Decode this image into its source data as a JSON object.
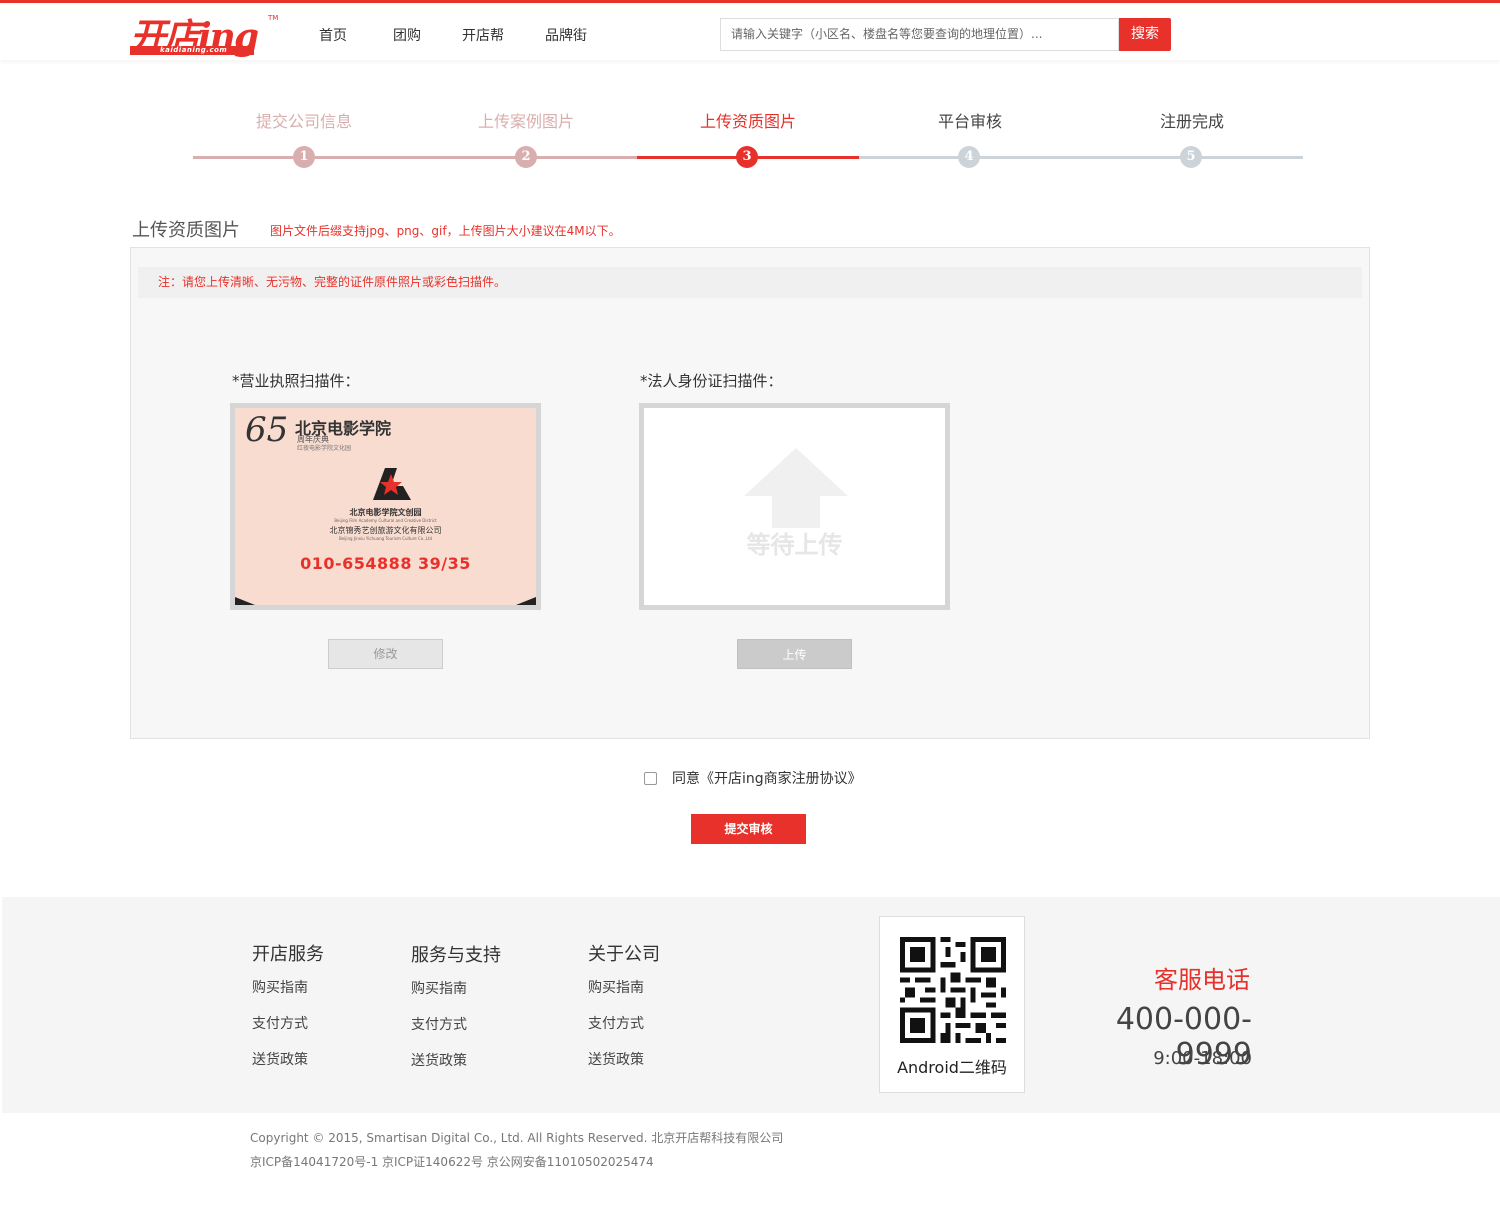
{
  "header": {
    "logo_text": "开店ing",
    "logo_sub": "kaidianing.com",
    "logo_tm": "TM",
    "nav": [
      "首页",
      "团购",
      "开店帮",
      "品牌街"
    ],
    "search_placeholder": "请输入关键字（小区名、楼盘名等您要查询的地理位置）...",
    "search_button": "搜索"
  },
  "steps": {
    "current": 3,
    "items": [
      {
        "label": "提交公司信息",
        "num": "1"
      },
      {
        "label": "上传案例图片",
        "num": "2"
      },
      {
        "label": "上传资质图片",
        "num": "3"
      },
      {
        "label": "平台审核",
        "num": "4"
      },
      {
        "label": "注册完成",
        "num": "5"
      }
    ]
  },
  "section": {
    "title": "上传资质图片",
    "hint": "图片文件后缀支持jpg、png、gif，上传图片大小建议在4M以下。",
    "note": "注：请您上传清晰、无污物、完整的证件原件照片或彩色扫描件。"
  },
  "uploads": {
    "license": {
      "label": "*营业执照扫描件：",
      "button": "修改",
      "card": {
        "brand": "北京电影学院",
        "num65": "65",
        "sub1": "周年庆典",
        "sub2": "红夜电影学院文化园",
        "line1": "北京电影学院文创园",
        "line2": "Beijing Film Academy Cultural and Creative District",
        "line3": "北京锦秀艺创旅游文化有限公司",
        "line4": "Beijing Jinxiu Yichuang Tourism Culture Co.,Ltd",
        "phone": "010-654888 39/35"
      }
    },
    "id_card": {
      "label": "*法人身份证扫描件：",
      "placeholder": "等待上传",
      "button": "上传"
    }
  },
  "agree_text": "同意《开店ing商家注册协议》",
  "agree_checked": false,
  "submit_button": "提交审核",
  "footer": {
    "columns": [
      {
        "title": "开店服务",
        "links": [
          "购买指南",
          "支付方式",
          "送货政策"
        ]
      },
      {
        "title": "服务与支持",
        "links": [
          "购买指南",
          "支付方式",
          "送货政策"
        ]
      },
      {
        "title": "关于公司",
        "links": [
          "购买指南",
          "支付方式",
          "送货政策"
        ]
      }
    ],
    "qr_label": "Android二维码",
    "service_title": "客服电话",
    "service_phone": "400-000-9999",
    "service_hours": "9:00-18:00",
    "copyright": "Copyright © 2015, Smartisan Digital Co., Ltd. All Rights Reserved. 北京开店帮科技有限公司",
    "icp": "京ICP备14041720号-1 京ICP证140622号 京公网安备11010502025474"
  },
  "colors": {
    "accent": "#e8312a",
    "done": "#d9aeae",
    "pending": "#ccd4da"
  }
}
